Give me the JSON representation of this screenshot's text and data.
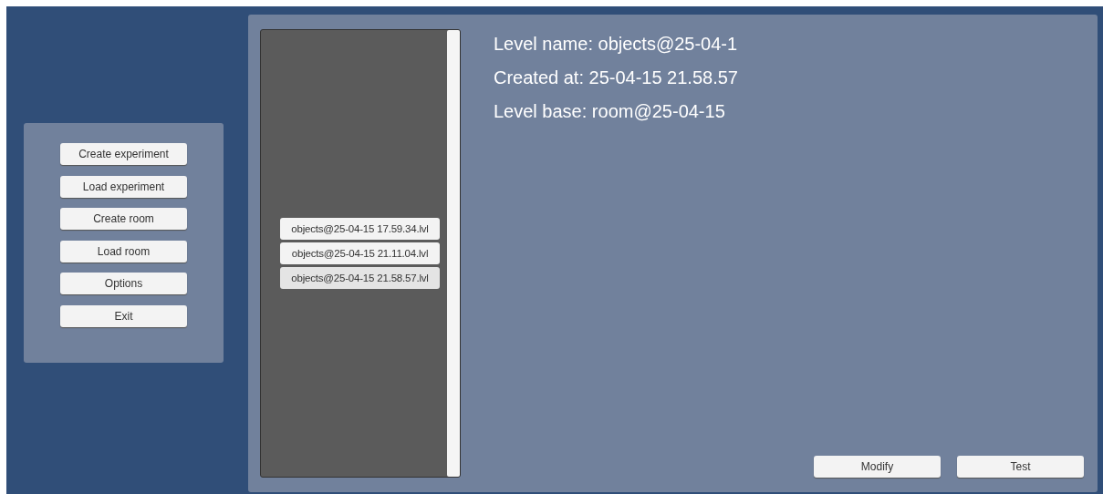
{
  "menu": {
    "buttons": [
      "Create experiment",
      "Load experiment",
      "Create room",
      "Load room",
      "Options",
      "Exit"
    ]
  },
  "level_list": {
    "items": [
      {
        "label": "objects@25-04-15 17.59.34.lvl",
        "selected": false
      },
      {
        "label": "objects@25-04-15 21.11.04.lvl",
        "selected": false
      },
      {
        "label": "objects@25-04-15 21.58.57.lvl",
        "selected": true
      }
    ]
  },
  "details": {
    "lines": [
      "Level name: objects@25-04-1",
      "Created at: 25-04-15 21.58.57",
      "Level base: room@25-04-15"
    ]
  },
  "actions": [
    "Modify",
    "Test"
  ]
}
